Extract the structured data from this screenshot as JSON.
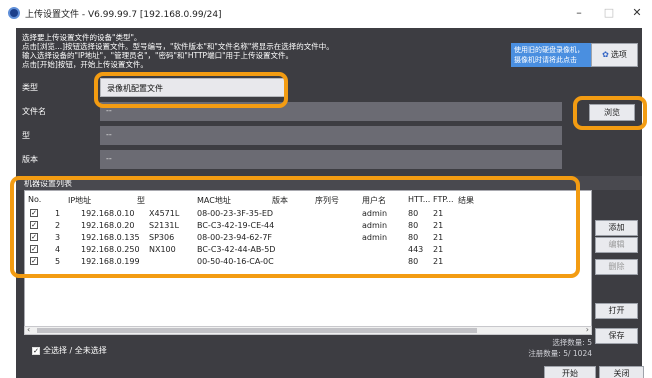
{
  "window": {
    "title": "上传设置文件 - V6.99.99.7 [192.168.0.99/24]",
    "minimize": "–",
    "maximize": "□",
    "close": "✕"
  },
  "info": {
    "lines": [
      "选择要上传设置文件的设备\"类型\"。",
      "点击[浏览...]按钮选择设置文件。型号编号，\"软件版本\"和\"文件名称\"将显示在选择的文件中。",
      "输入选择设备的\"IP地址\"，\"管理员名\"，\"密码\"和\"HTTP端口\"用于上传设置文件。",
      "点击[开始]按钮，开始上传设置文件。"
    ],
    "notice": "使用旧的硬盘录像机，摄像机时请将此点击",
    "options_label": "选项"
  },
  "fields": {
    "type_label": "类型",
    "type_value": "录像机配置文件",
    "filename_label": "文件名",
    "filename_value": "--",
    "model_label": "型",
    "model_value": "--",
    "version_label": "版本",
    "version_value": "--",
    "browse_label": "浏览"
  },
  "list": {
    "title": "机器设置列表",
    "columns": [
      "No.",
      "IP地址",
      "型",
      "MAC地址",
      "版本",
      "序列号",
      "用户名",
      "HTT...",
      "FTP...",
      "结果"
    ],
    "rows": [
      {
        "no": "1",
        "ip": "192.168.0.10",
        "model": "X4571L",
        "mac": "08-00-23-3F-35-ED",
        "user": "admin",
        "http": "80",
        "ftp": "21"
      },
      {
        "no": "2",
        "ip": "192.168.0.20",
        "model": "S2131L",
        "mac": "BC-C3-42-19-CE-44",
        "user": "admin",
        "http": "80",
        "ftp": "21"
      },
      {
        "no": "3",
        "ip": "192.168.0.135",
        "model": "SP306",
        "mac": "08-00-23-94-62-7F",
        "user": "admin",
        "http": "80",
        "ftp": "21"
      },
      {
        "no": "4",
        "ip": "192.168.0.250",
        "model": "NX100",
        "mac": "BC-C3-42-44-AB-5D",
        "user": "",
        "http": "443",
        "ftp": "21"
      },
      {
        "no": "5",
        "ip": "192.168.0.199",
        "model": "",
        "mac": "00-50-40-16-CA-0C",
        "user": "",
        "http": "80",
        "ftp": "21"
      }
    ],
    "add_label": "添加",
    "edit_label": "编辑",
    "delete_label": "删除",
    "open_label": "打开",
    "save_label": "保存",
    "select_all_label": "全选择 / 全未选择",
    "selected_count": "选择数量: 5",
    "registered_count": "注册数量:   5/ 1024"
  },
  "footer": {
    "start_label": "开始",
    "close_label": "关闭"
  },
  "colors": {
    "panel_bg": "#3d3d42",
    "field_bg": "#6b6b73",
    "notice_bg": "#4a8fe0",
    "highlight": "#f39c12"
  }
}
